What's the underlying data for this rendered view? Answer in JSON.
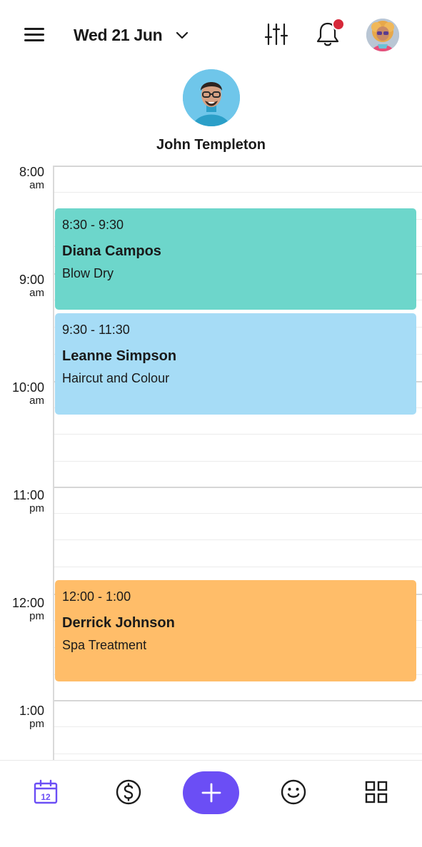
{
  "header": {
    "menu_icon": "hamburger-menu-icon",
    "date_label": "Wed 21 Jun",
    "date_chevron_icon": "chevron-down-icon",
    "filter_icon": "sliders-filter-icon",
    "notifications_icon": "bell-icon",
    "has_unread_notifications": true,
    "notification_dot_color": "#d62839",
    "user_avatar": "user-avatar-photo"
  },
  "staff": {
    "name": "John Templeton",
    "avatar": "staff-avatar-photo"
  },
  "calendar": {
    "time_labels": [
      {
        "time": "8:00",
        "meridiem": "am"
      },
      {
        "time": "9:00",
        "meridiem": "am"
      },
      {
        "time": "10:00",
        "meridiem": "am"
      },
      {
        "time": "11:00",
        "meridiem": "pm"
      },
      {
        "time": "12:00",
        "meridiem": "pm"
      },
      {
        "time": "1:00",
        "meridiem": "pm"
      }
    ],
    "appointments": [
      {
        "time": "8:30 - 9:30",
        "client": "Diana Campos",
        "service": "Blow Dry",
        "color": "#6dd6cb"
      },
      {
        "time": "9:30 - 11:30",
        "client": "Leanne Simpson",
        "service": "Haircut and Colour",
        "color": "#a6dcf6"
      },
      {
        "time": "12:00 - 1:00",
        "client": "Derrick Johnson",
        "service": "Spa Treatment",
        "color": "#ffbd69"
      }
    ]
  },
  "bottom_nav": {
    "items": [
      {
        "icon": "calendar-icon",
        "label": "12",
        "active": true
      },
      {
        "icon": "dollar-icon",
        "active": false
      },
      {
        "icon": "plus-icon",
        "active": false
      },
      {
        "icon": "smiley-icon",
        "active": false
      },
      {
        "icon": "grid-icon",
        "active": false
      }
    ],
    "accent_color": "#6b4ef5"
  }
}
